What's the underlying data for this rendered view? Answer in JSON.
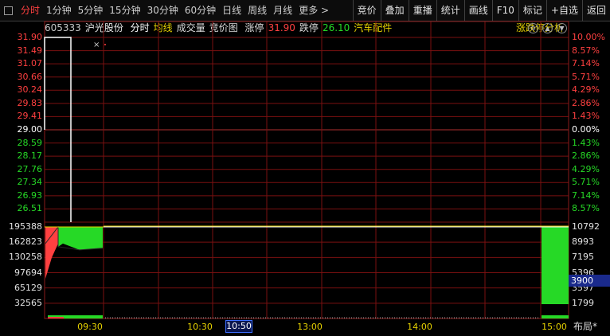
{
  "toolbar": {
    "tabs": [
      {
        "label": "分时",
        "active": true
      },
      {
        "label": "1分钟"
      },
      {
        "label": "5分钟"
      },
      {
        "label": "15分钟"
      },
      {
        "label": "30分钟"
      },
      {
        "label": "60分钟"
      },
      {
        "label": "日线"
      },
      {
        "label": "周线"
      },
      {
        "label": "月线"
      },
      {
        "label": "更多 >"
      }
    ],
    "buttons": [
      "竞价",
      "叠加",
      "重播",
      "统计",
      "画线",
      "F10",
      "标记",
      "+自选",
      "返回"
    ]
  },
  "info": {
    "code": "605333",
    "name": "沪光股份",
    "mode": "分时",
    "avg_line": "均线",
    "volume": "成交量",
    "auction_chart": "竞价图",
    "limit_up_label": "涨停",
    "limit_up_value": "31.90",
    "limit_down_label": "跌停",
    "limit_down_value": "26.10",
    "sector": "汽车配件",
    "analysis": "涨跌停分析"
  },
  "price_axis": {
    "left": [
      "31.90",
      "31.49",
      "31.07",
      "30.66",
      "30.24",
      "29.83",
      "29.41",
      "29.00",
      "28.59",
      "28.17",
      "27.76",
      "27.34",
      "26.93",
      "26.51"
    ],
    "right": [
      "10.00%",
      "8.57%",
      "7.14%",
      "5.71%",
      "4.29%",
      "2.86%",
      "1.43%",
      "0.00%",
      "1.43%",
      "2.86%",
      "4.29%",
      "5.71%",
      "7.14%",
      "8.57%"
    ]
  },
  "volume_axis": {
    "left": [
      "195388",
      "162823",
      "130258",
      "97694",
      "65129",
      "32565"
    ],
    "right": [
      "10792",
      "8993",
      "7195",
      "5396",
      "3597",
      "1799"
    ],
    "cursor_value": "3900"
  },
  "time_axis": {
    "labels": [
      "09:30",
      "10:30",
      "13:00",
      "14:00",
      "15:00"
    ],
    "cursor": "10:50"
  },
  "layout_label": "布局*",
  "colors": {
    "up": "#ff4040",
    "down": "#26d926",
    "grid": "#7a1010",
    "background": "#000000",
    "price_line": "#ffffff",
    "avg_line": "#e6d200"
  },
  "chart_data": {
    "type": "line",
    "prev_close": 29.0,
    "limit_up": 31.9,
    "limit_down": 26.1,
    "ylim": [
      26.1,
      31.9
    ],
    "price": [
      {
        "t": "09:25",
        "v": 29.0
      },
      {
        "t": "09:26",
        "v": 31.9
      },
      {
        "t": "09:30",
        "v": 31.9
      },
      {
        "t": "15:00",
        "v": 31.9
      }
    ],
    "volume_ylim": [
      0,
      195388
    ],
    "auction_volume": [
      {
        "t": "09:15",
        "buy": 130000,
        "sell": 195388
      },
      {
        "t": "09:20",
        "buy": 160000,
        "sell": 180000
      },
      {
        "t": "09:25",
        "buy": 195388,
        "sell": 150000
      }
    ],
    "closing_volume_ylim": [
      0,
      10792
    ],
    "closing_auction_volume": [
      10792
    ]
  }
}
